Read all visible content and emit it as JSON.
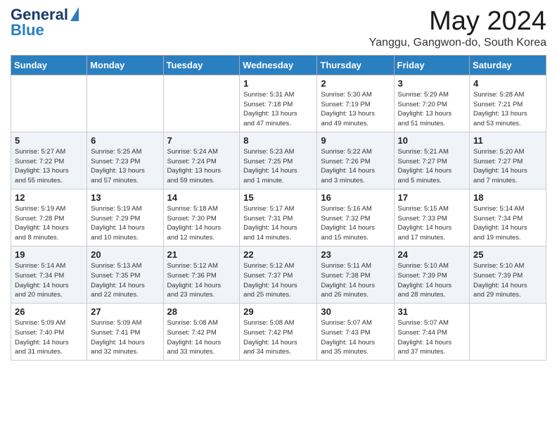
{
  "logo": {
    "general": "General",
    "blue": "Blue"
  },
  "header": {
    "month": "May 2024",
    "location": "Yanggu, Gangwon-do, South Korea"
  },
  "days_of_week": [
    "Sunday",
    "Monday",
    "Tuesday",
    "Wednesday",
    "Thursday",
    "Friday",
    "Saturday"
  ],
  "weeks": [
    [
      {
        "day": "",
        "info": ""
      },
      {
        "day": "",
        "info": ""
      },
      {
        "day": "",
        "info": ""
      },
      {
        "day": "1",
        "info": "Sunrise: 5:31 AM\nSunset: 7:18 PM\nDaylight: 13 hours\nand 47 minutes."
      },
      {
        "day": "2",
        "info": "Sunrise: 5:30 AM\nSunset: 7:19 PM\nDaylight: 13 hours\nand 49 minutes."
      },
      {
        "day": "3",
        "info": "Sunrise: 5:29 AM\nSunset: 7:20 PM\nDaylight: 13 hours\nand 51 minutes."
      },
      {
        "day": "4",
        "info": "Sunrise: 5:28 AM\nSunset: 7:21 PM\nDaylight: 13 hours\nand 53 minutes."
      }
    ],
    [
      {
        "day": "5",
        "info": "Sunrise: 5:27 AM\nSunset: 7:22 PM\nDaylight: 13 hours\nand 55 minutes."
      },
      {
        "day": "6",
        "info": "Sunrise: 5:25 AM\nSunset: 7:23 PM\nDaylight: 13 hours\nand 57 minutes."
      },
      {
        "day": "7",
        "info": "Sunrise: 5:24 AM\nSunset: 7:24 PM\nDaylight: 13 hours\nand 59 minutes."
      },
      {
        "day": "8",
        "info": "Sunrise: 5:23 AM\nSunset: 7:25 PM\nDaylight: 14 hours\nand 1 minute."
      },
      {
        "day": "9",
        "info": "Sunrise: 5:22 AM\nSunset: 7:26 PM\nDaylight: 14 hours\nand 3 minutes."
      },
      {
        "day": "10",
        "info": "Sunrise: 5:21 AM\nSunset: 7:27 PM\nDaylight: 14 hours\nand 5 minutes."
      },
      {
        "day": "11",
        "info": "Sunrise: 5:20 AM\nSunset: 7:27 PM\nDaylight: 14 hours\nand 7 minutes."
      }
    ],
    [
      {
        "day": "12",
        "info": "Sunrise: 5:19 AM\nSunset: 7:28 PM\nDaylight: 14 hours\nand 8 minutes."
      },
      {
        "day": "13",
        "info": "Sunrise: 5:19 AM\nSunset: 7:29 PM\nDaylight: 14 hours\nand 10 minutes."
      },
      {
        "day": "14",
        "info": "Sunrise: 5:18 AM\nSunset: 7:30 PM\nDaylight: 14 hours\nand 12 minutes."
      },
      {
        "day": "15",
        "info": "Sunrise: 5:17 AM\nSunset: 7:31 PM\nDaylight: 14 hours\nand 14 minutes."
      },
      {
        "day": "16",
        "info": "Sunrise: 5:16 AM\nSunset: 7:32 PM\nDaylight: 14 hours\nand 15 minutes."
      },
      {
        "day": "17",
        "info": "Sunrise: 5:15 AM\nSunset: 7:33 PM\nDaylight: 14 hours\nand 17 minutes."
      },
      {
        "day": "18",
        "info": "Sunrise: 5:14 AM\nSunset: 7:34 PM\nDaylight: 14 hours\nand 19 minutes."
      }
    ],
    [
      {
        "day": "19",
        "info": "Sunrise: 5:14 AM\nSunset: 7:34 PM\nDaylight: 14 hours\nand 20 minutes."
      },
      {
        "day": "20",
        "info": "Sunrise: 5:13 AM\nSunset: 7:35 PM\nDaylight: 14 hours\nand 22 minutes."
      },
      {
        "day": "21",
        "info": "Sunrise: 5:12 AM\nSunset: 7:36 PM\nDaylight: 14 hours\nand 23 minutes."
      },
      {
        "day": "22",
        "info": "Sunrise: 5:12 AM\nSunset: 7:37 PM\nDaylight: 14 hours\nand 25 minutes."
      },
      {
        "day": "23",
        "info": "Sunrise: 5:11 AM\nSunset: 7:38 PM\nDaylight: 14 hours\nand 26 minutes."
      },
      {
        "day": "24",
        "info": "Sunrise: 5:10 AM\nSunset: 7:39 PM\nDaylight: 14 hours\nand 28 minutes."
      },
      {
        "day": "25",
        "info": "Sunrise: 5:10 AM\nSunset: 7:39 PM\nDaylight: 14 hours\nand 29 minutes."
      }
    ],
    [
      {
        "day": "26",
        "info": "Sunrise: 5:09 AM\nSunset: 7:40 PM\nDaylight: 14 hours\nand 31 minutes."
      },
      {
        "day": "27",
        "info": "Sunrise: 5:09 AM\nSunset: 7:41 PM\nDaylight: 14 hours\nand 32 minutes."
      },
      {
        "day": "28",
        "info": "Sunrise: 5:08 AM\nSunset: 7:42 PM\nDaylight: 14 hours\nand 33 minutes."
      },
      {
        "day": "29",
        "info": "Sunrise: 5:08 AM\nSunset: 7:42 PM\nDaylight: 14 hours\nand 34 minutes."
      },
      {
        "day": "30",
        "info": "Sunrise: 5:07 AM\nSunset: 7:43 PM\nDaylight: 14 hours\nand 35 minutes."
      },
      {
        "day": "31",
        "info": "Sunrise: 5:07 AM\nSunset: 7:44 PM\nDaylight: 14 hours\nand 37 minutes."
      },
      {
        "day": "",
        "info": ""
      }
    ]
  ]
}
